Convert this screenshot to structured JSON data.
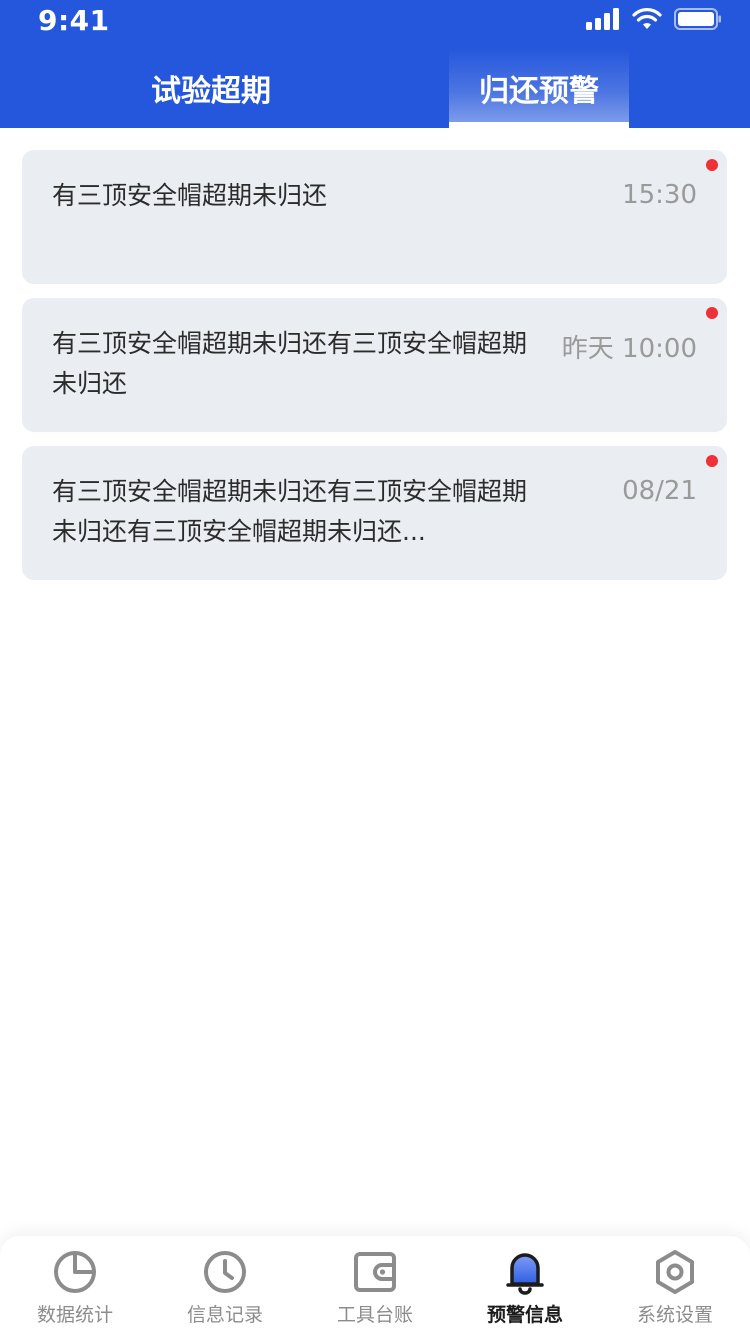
{
  "status_bar": {
    "time": "9:41"
  },
  "tabs": [
    {
      "label": "试验超期",
      "active": false
    },
    {
      "label": "归还预警",
      "active": true
    }
  ],
  "alerts": [
    {
      "text": "有三顶安全帽超期未归还",
      "time": "15:30",
      "unread": true
    },
    {
      "text": "有三顶安全帽超期未归还有三顶安全帽超期未归还",
      "time": "昨天 10:00",
      "unread": true
    },
    {
      "text": "有三顶安全帽超期未归还有三顶安全帽超期未归还有三顶安全帽超期未归还...",
      "time": "08/21",
      "unread": true
    }
  ],
  "bottom_nav": {
    "items": [
      {
        "label": "数据统计",
        "icon": "pie-chart-icon",
        "active": false
      },
      {
        "label": "信息记录",
        "icon": "clock-icon",
        "active": false
      },
      {
        "label": "工具台账",
        "icon": "wallet-icon",
        "active": false
      },
      {
        "label": "预警信息",
        "icon": "bell-icon",
        "active": true
      },
      {
        "label": "系统设置",
        "icon": "hexagon-settings-icon",
        "active": false
      }
    ]
  },
  "colors": {
    "header_blue": "#2557dc",
    "card_bg": "#eaedf2",
    "unread_dot": "#f03037",
    "muted_text": "#9a9a9a"
  }
}
